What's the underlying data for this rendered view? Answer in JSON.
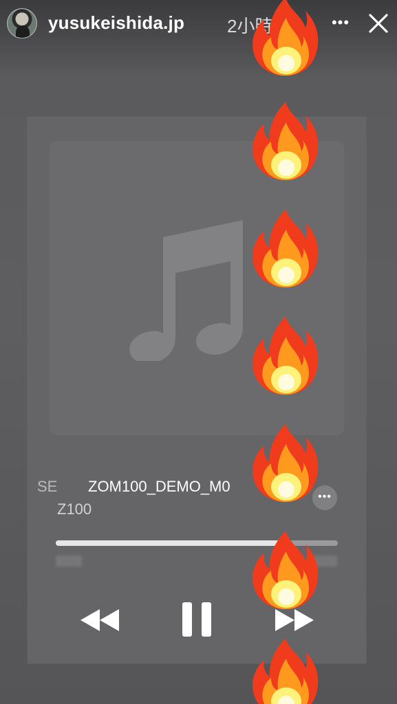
{
  "header": {
    "username": "yusukeishida.jp",
    "timestamp": "2小時",
    "more_label": "•••"
  },
  "player": {
    "title_prefix": "SE",
    "track_title": "ZOM100_DEMO_M0",
    "artist": "Z100",
    "more_label": "•••",
    "progress_fraction": 0.81
  },
  "icons": {
    "avatar": "profile-avatar",
    "more": "ellipsis-icon",
    "close": "close-icon",
    "artwork": "music-note-icon",
    "rewind": "rewind-icon",
    "pause": "pause-icon",
    "forward": "fast-forward-icon",
    "sticker": "fire-emoji"
  },
  "colors": {
    "progress_fill": "#e6e6e6",
    "progress_track": "#8b8b8d",
    "fire_outer": "#f03b1c",
    "fire_mid": "#ff9a1f",
    "fire_inner": "#fff27a"
  },
  "fire_sticker_count": 7
}
